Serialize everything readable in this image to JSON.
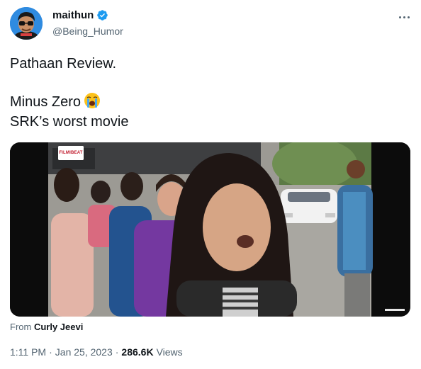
{
  "author": {
    "display_name": "maithun",
    "handle": "@Being_Humor",
    "verified": true,
    "avatar_icon": "avatar-cartoon-icon"
  },
  "tweet": {
    "line1": "Pathaan Review.",
    "line2": "Minus Zero",
    "line2_emoji": "loudly-crying-face-icon",
    "line3": "SRK’s worst movie"
  },
  "media": {
    "type": "video",
    "channel_logo_text": "FILMIBEAT"
  },
  "from": {
    "prefix": "From",
    "source": "Curly Jeevi"
  },
  "meta": {
    "time": "1:11 PM",
    "separator1": "·",
    "date": "Jan 25, 2023",
    "separator2": "·",
    "views_count": "286.6K",
    "views_label": "Views"
  },
  "colors": {
    "verified_badge": "#1d9bf0",
    "secondary_text": "#536471",
    "primary_text": "#0f1419"
  }
}
